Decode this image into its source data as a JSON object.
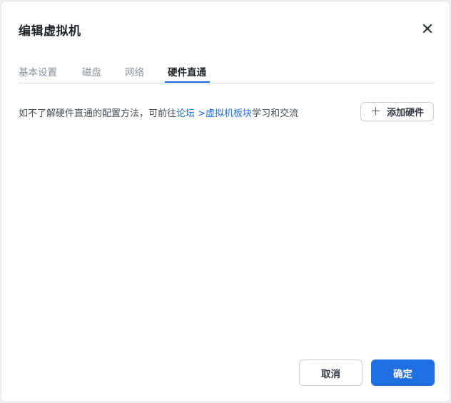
{
  "dialog": {
    "title": "编辑虚拟机",
    "close_icon": "close-icon"
  },
  "tabs": [
    {
      "label": "基本设置",
      "active": false
    },
    {
      "label": "磁盘",
      "active": false
    },
    {
      "label": "网络",
      "active": false
    },
    {
      "label": "硬件直通",
      "active": true
    }
  ],
  "content": {
    "info_prefix": "如不了解硬件直通的配置方法，可前往",
    "link_forum": "论坛",
    "link_vm_board": " >虚拟机板块",
    "info_suffix": "学习和交流",
    "add_button_label": "添加硬件",
    "add_icon": "plus-icon"
  },
  "footer": {
    "cancel_label": "取消",
    "confirm_label": "确定"
  },
  "colors": {
    "accent": "#1f6fe0",
    "text_primary": "#1f2329",
    "text_muted": "#8a93a0"
  }
}
